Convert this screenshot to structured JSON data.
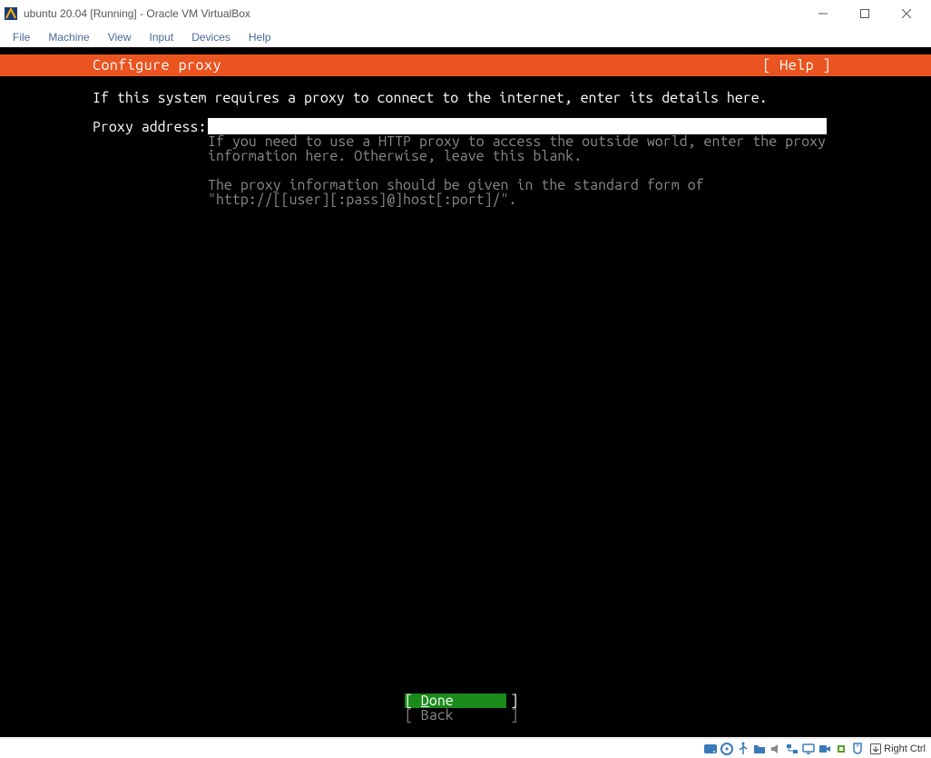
{
  "titlebar": {
    "title": "ubuntu 20.04 [Running] - Oracle VM VirtualBox"
  },
  "menubar": {
    "items": [
      "File",
      "Machine",
      "View",
      "Input",
      "Devices",
      "Help"
    ]
  },
  "guest": {
    "header": {
      "title": "Configure proxy",
      "help": "[ Help ]"
    },
    "instruction": "If this system requires a proxy to connect to the internet, enter its details here.",
    "proxy_label": "Proxy address:",
    "proxy_value": "",
    "help_text_1": "If you need to use a HTTP proxy to access the outside world, enter the proxy\ninformation here. Otherwise, leave this blank.",
    "help_text_2": "The proxy information should be given in the standard form of\n\"http://[[user][:pass]@]host[:port]/\".",
    "buttons": {
      "done_prefix": "[ ",
      "done_letter": "D",
      "done_rest": "one       ]",
      "back": "[ Back       ]"
    }
  },
  "statusbar": {
    "host_key": "Right Ctrl",
    "icons": [
      "hard-disk-icon",
      "optical-disk-icon",
      "usb-icon",
      "shared-folder-icon",
      "audio-icon",
      "network-icon",
      "display-icon",
      "recording-icon",
      "processor-icon",
      "mouse-integration-icon"
    ]
  }
}
